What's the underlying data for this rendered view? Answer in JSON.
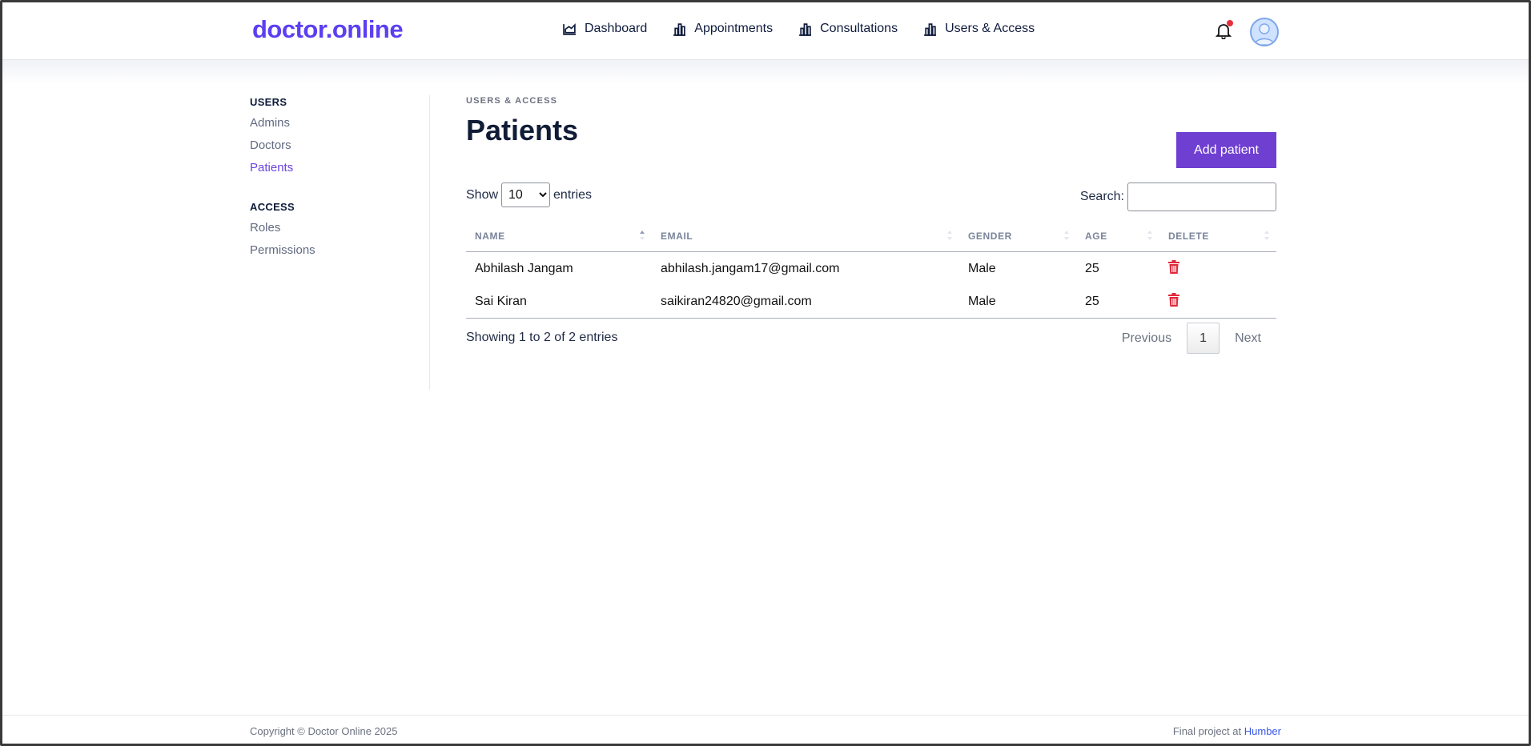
{
  "brand": {
    "logo": "doctor.online",
    "accent": "#5b3ff2"
  },
  "nav": {
    "items": [
      {
        "label": "Dashboard",
        "icon": "chart-area-icon"
      },
      {
        "label": "Appointments",
        "icon": "bar-chart-icon"
      },
      {
        "label": "Consultations",
        "icon": "bar-chart-icon"
      },
      {
        "label": "Users & Access",
        "icon": "bar-chart-icon"
      }
    ],
    "notification_icon": "bell-icon",
    "notification_dot_color": "#e5303c",
    "avatar_icon": "user-avatar-icon"
  },
  "sidebar": {
    "groups": [
      {
        "heading": "USERS",
        "items": [
          "Admins",
          "Doctors",
          "Patients"
        ]
      },
      {
        "heading": "ACCESS",
        "items": [
          "Roles",
          "Permissions"
        ]
      }
    ],
    "active": "Patients"
  },
  "main": {
    "eyebrow": "USERS & ACCESS",
    "title": "Patients",
    "add_button": "Add patient",
    "add_button_color": "#6f3fd2",
    "show_label": "Show",
    "entries_label": "entries",
    "page_size": "10",
    "search_label": "Search:",
    "search_value": "",
    "table": {
      "columns": [
        "NAME",
        "EMAIL",
        "GENDER",
        "AGE",
        "DELETE"
      ],
      "sorted_column": "NAME",
      "sort_direction": "asc",
      "rows": [
        {
          "name": "Abhilash Jangam",
          "email": "abhilash.jangam17@gmail.com",
          "gender": "Male",
          "age": "25"
        },
        {
          "name": "Sai Kiran",
          "email": "saikiran24820@gmail.com",
          "gender": "Male",
          "age": "25"
        }
      ],
      "delete_icon": "trash-icon",
      "delete_color": "#e0283a"
    },
    "info": "Showing 1 to 2 of 2 entries",
    "pager": {
      "previous": "Previous",
      "current": "1",
      "next": "Next"
    }
  },
  "footer": {
    "copyright": "Copyright © Doctor Online 2025",
    "credit_prefix": "Final project at",
    "credit_link": "Humber"
  }
}
